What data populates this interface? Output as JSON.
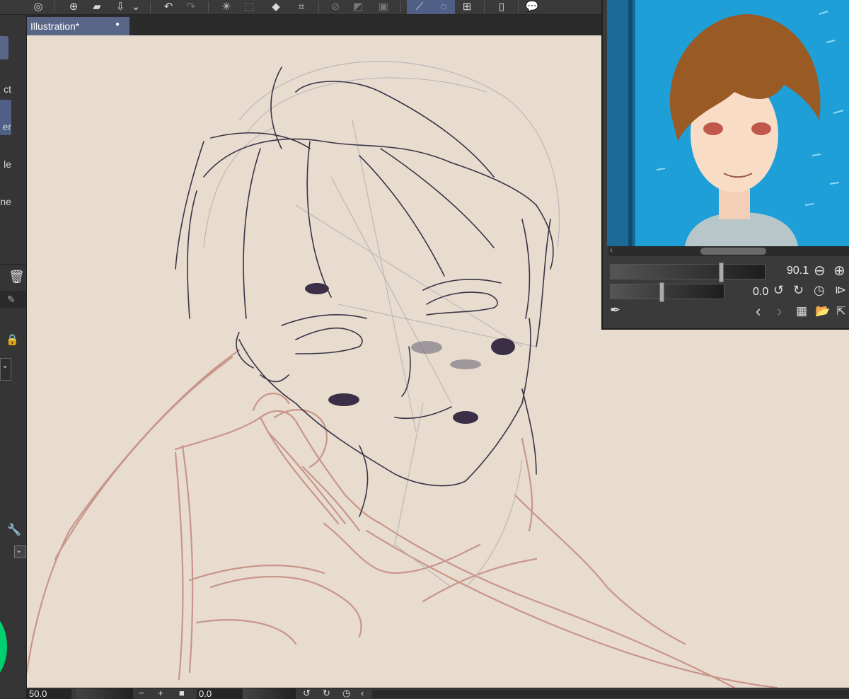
{
  "document": {
    "tab_title": "Illustration*",
    "tab_modified_marker": "●"
  },
  "left_panel": {
    "items": [
      {
        "label": "ct"
      },
      {
        "label": "er"
      },
      {
        "label": "le"
      },
      {
        "label": "ne"
      }
    ]
  },
  "navigator": {
    "zoom_value": "90.1",
    "rotation_value": "0.0",
    "zoom_level": 0.72,
    "rotation_level": 0.45
  },
  "status_bar": {
    "zoom_value": "50.0",
    "rotation_value": "0.0"
  },
  "colors": {
    "canvas": "#e7dccd",
    "toolbar": "#3a3a3a",
    "active_tab": "#5a6687",
    "sketch_red": "#c9958b",
    "line_art": "#3a3448"
  }
}
